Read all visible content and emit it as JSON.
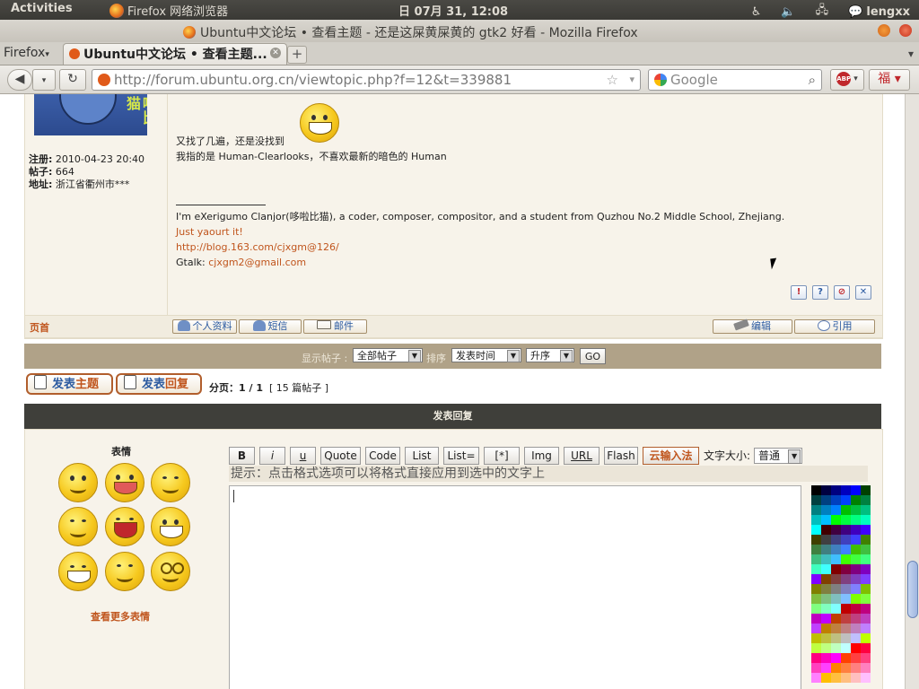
{
  "panel": {
    "activities": "Activities",
    "app_name": "Firefox 网络浏览器",
    "clock": "日 07月 31, 12:08",
    "user": "lengxx"
  },
  "window": {
    "title": "Ubuntu中文论坛 • 查看主题 - 还是这屎黄屎黄的 gtk2 好看 - Mozilla Firefox"
  },
  "tabs": {
    "firefox_menu": "Firefox",
    "active_tab": "Ubuntu中文论坛 • 查看主题...",
    "new_tab": "+"
  },
  "nav": {
    "url": "http://forum.ubuntu.org.cn/viewtopic.php?f=12&t=339881",
    "search_placeholder": "Google",
    "abp_label": "ABP"
  },
  "post": {
    "avatar_text": "啦比猫",
    "user_info": [
      {
        "label": "注册:",
        "value": "2010-04-23 20:40"
      },
      {
        "label": "帖子:",
        "value": "664"
      },
      {
        "label": "地址:",
        "value": "浙江省衢州市***"
      }
    ],
    "lines": [
      "又找了几遍，还是没找到",
      "我指的是 Human-Clearlooks，不喜欢最新的暗色的 Human"
    ],
    "signature": {
      "intro": "I'm eXerigumo Clanjor(哆啦比猫), a coder, composer, compositor, and a student from Quzhou No.2 Middle School, Zhejiang.",
      "line2": "Just yaourt it!",
      "blog": "http://blog.163.com/cjxgm@126/",
      "gtalk_label": "Gtalk:",
      "gtalk": "cjxgm2@gmail.com"
    },
    "action_icons": [
      "!",
      "?",
      "⊘",
      "✕"
    ],
    "footer": {
      "home": "页首",
      "profile": "个人资料",
      "pm": "短信",
      "email": "邮件",
      "edit": "编辑",
      "quote": "引用"
    }
  },
  "filter": {
    "display_label": "显示帖子 :",
    "display_value": "全部帖子",
    "sort_label": "排序",
    "sort_value": "发表时间",
    "order_value": "升序",
    "go": "GO"
  },
  "actions": {
    "new_topic_a": "发表",
    "new_topic_b": "主题",
    "reply_a": "发表",
    "reply_b": "回复",
    "page_label": "分页：",
    "page_value": "1 / 1",
    "post_count": "[ 15 篇帖子 ]"
  },
  "reply": {
    "header": "发表回复",
    "emoticon_title": "表情",
    "more_emoticons": "查看更多表情",
    "format_buttons": [
      "B",
      "i",
      "u",
      "Quote",
      "Code",
      "List",
      "List=",
      "[*]",
      "Img",
      "URL",
      "Flash",
      "云输入法"
    ],
    "font_size_label": "文字大小:",
    "font_size_value": "普通",
    "hint": "提示：点击格式选项可以将格式直接应用到选中的文字上"
  },
  "colors": {
    "accent": "#c0551d",
    "link": "#2b5aa0",
    "post_bg": "#f7f3ea",
    "strip_bg": "#b0a288",
    "header_bg": "#3f3f3a"
  }
}
